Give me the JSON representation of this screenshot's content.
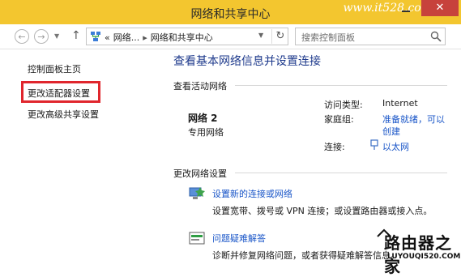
{
  "window": {
    "title": "网络和共享中心",
    "watermark": "www.it528.com",
    "close_label": "✕"
  },
  "nav": {
    "back_icon": "back-arrow-icon",
    "forward_icon": "forward-arrow-icon",
    "up_icon": "up-arrow-icon",
    "breadcrumb_prefix": "«",
    "breadcrumb_1": "网络...",
    "breadcrumb_2": "网络和共享中心",
    "search_placeholder": "搜索控制面板"
  },
  "sidebar": {
    "items": [
      {
        "label": "控制面板主页"
      },
      {
        "label": "更改适配器设置"
      },
      {
        "label": "更改高级共享设置"
      }
    ]
  },
  "main": {
    "title": "查看基本网络信息并设置连接",
    "active_section": "查看活动网络",
    "network": {
      "name": "网络  2",
      "type": "专用网络",
      "access_type_label": "访问类型:",
      "access_type_value": "Internet",
      "homegroup_label": "家庭组:",
      "homegroup_value_1": "准备就绪，可以",
      "homegroup_value_2": "创建",
      "connection_label": "连接:",
      "connection_value": "以太网"
    },
    "change_section": "更改网络设置",
    "tasks": [
      {
        "link": "设置新的连接或网络",
        "desc": "设置宽带、拨号或 VPN 连接；或设置路由器或接入点。"
      },
      {
        "link": "问题疑难解答",
        "desc": "诊断并修复网络问题，或者获得疑难解答信息。"
      }
    ]
  },
  "logo": {
    "line1": "路由器之家",
    "line2": "LUYOUQI520.COM"
  },
  "colors": {
    "titlebar": "#f3c62f",
    "close": "#c7423c",
    "highlight": "#e0262d",
    "link": "#1a56c8",
    "heading": "#1e3a8c"
  }
}
